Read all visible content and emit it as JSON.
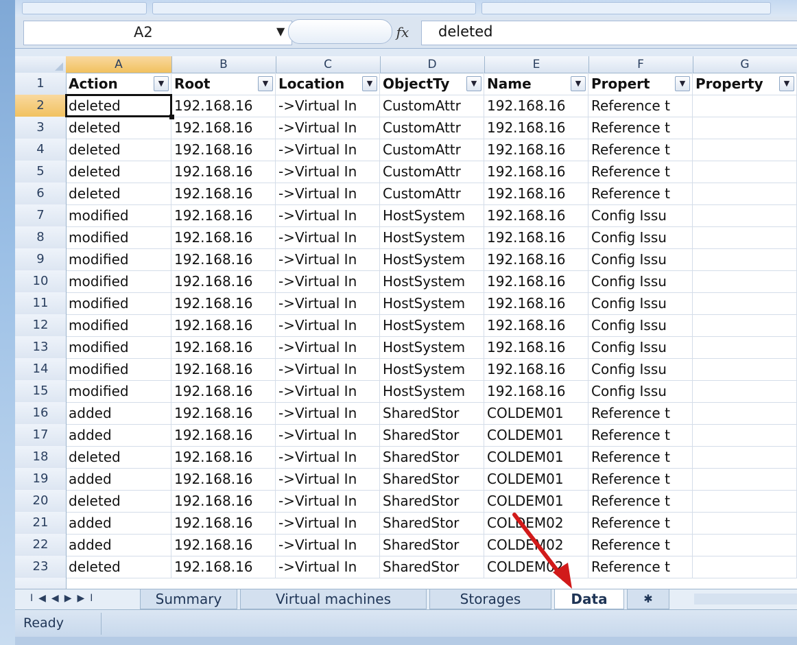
{
  "formula_bar": {
    "name_box": "A2",
    "fx_label": "fx",
    "content": "deleted"
  },
  "columns": [
    "A",
    "B",
    "C",
    "D",
    "E",
    "F",
    "G"
  ],
  "header_row": {
    "number": "1",
    "cells": [
      "Action",
      "Root",
      "Location",
      "ObjectTy",
      "Name",
      "Propert",
      "Property"
    ]
  },
  "rows": [
    {
      "n": "2",
      "cells": [
        "deleted",
        "192.168.16",
        "->Virtual In",
        "CustomAttr",
        "192.168.16",
        "Reference t"
      ]
    },
    {
      "n": "3",
      "cells": [
        "deleted",
        "192.168.16",
        "->Virtual In",
        "CustomAttr",
        "192.168.16",
        "Reference t"
      ]
    },
    {
      "n": "4",
      "cells": [
        "deleted",
        "192.168.16",
        "->Virtual In",
        "CustomAttr",
        "192.168.16",
        "Reference t"
      ]
    },
    {
      "n": "5",
      "cells": [
        "deleted",
        "192.168.16",
        "->Virtual In",
        "CustomAttr",
        "192.168.16",
        "Reference t"
      ]
    },
    {
      "n": "6",
      "cells": [
        "deleted",
        "192.168.16",
        "->Virtual In",
        "CustomAttr",
        "192.168.16",
        "Reference t"
      ]
    },
    {
      "n": "7",
      "cells": [
        "modified",
        "192.168.16",
        "->Virtual In",
        "HostSystem",
        "192.168.16",
        "Config Issu"
      ]
    },
    {
      "n": "8",
      "cells": [
        "modified",
        "192.168.16",
        "->Virtual In",
        "HostSystem",
        "192.168.16",
        "Config Issu"
      ]
    },
    {
      "n": "9",
      "cells": [
        "modified",
        "192.168.16",
        "->Virtual In",
        "HostSystem",
        "192.168.16",
        "Config Issu"
      ]
    },
    {
      "n": "10",
      "cells": [
        "modified",
        "192.168.16",
        "->Virtual In",
        "HostSystem",
        "192.168.16",
        "Config Issu"
      ]
    },
    {
      "n": "11",
      "cells": [
        "modified",
        "192.168.16",
        "->Virtual In",
        "HostSystem",
        "192.168.16",
        "Config Issu"
      ]
    },
    {
      "n": "12",
      "cells": [
        "modified",
        "192.168.16",
        "->Virtual In",
        "HostSystem",
        "192.168.16",
        "Config Issu"
      ]
    },
    {
      "n": "13",
      "cells": [
        "modified",
        "192.168.16",
        "->Virtual In",
        "HostSystem",
        "192.168.16",
        "Config Issu"
      ]
    },
    {
      "n": "14",
      "cells": [
        "modified",
        "192.168.16",
        "->Virtual In",
        "HostSystem",
        "192.168.16",
        "Config Issu"
      ]
    },
    {
      "n": "15",
      "cells": [
        "modified",
        "192.168.16",
        "->Virtual In",
        "HostSystem",
        "192.168.16",
        "Config Issu"
      ]
    },
    {
      "n": "16",
      "cells": [
        "added",
        "192.168.16",
        "->Virtual In",
        "SharedStor",
        "COLDEM01",
        "Reference t"
      ]
    },
    {
      "n": "17",
      "cells": [
        "added",
        "192.168.16",
        "->Virtual In",
        "SharedStor",
        "COLDEM01",
        "Reference t"
      ]
    },
    {
      "n": "18",
      "cells": [
        "deleted",
        "192.168.16",
        "->Virtual In",
        "SharedStor",
        "COLDEM01",
        "Reference t"
      ]
    },
    {
      "n": "19",
      "cells": [
        "added",
        "192.168.16",
        "->Virtual In",
        "SharedStor",
        "COLDEM01",
        "Reference t"
      ]
    },
    {
      "n": "20",
      "cells": [
        "deleted",
        "192.168.16",
        "->Virtual In",
        "SharedStor",
        "COLDEM01",
        "Reference t"
      ]
    },
    {
      "n": "21",
      "cells": [
        "added",
        "192.168.16",
        "->Virtual In",
        "SharedStor",
        "COLDEM02",
        "Reference t"
      ]
    },
    {
      "n": "22",
      "cells": [
        "added",
        "192.168.16",
        "->Virtual In",
        "SharedStor",
        "COLDEM02",
        "Reference t"
      ]
    },
    {
      "n": "23",
      "cells": [
        "deleted",
        "192.168.16",
        "->Virtual In",
        "SharedStor",
        "COLDEM02",
        "Reference t"
      ]
    }
  ],
  "sheet_tabs": {
    "nav_icons": [
      "first-sheet-icon",
      "prev-sheet-icon",
      "next-sheet-icon",
      "last-sheet-icon"
    ],
    "tabs": [
      "Summary",
      "Virtual machines",
      "Storages",
      "Data"
    ],
    "active": "Data"
  },
  "status_bar": {
    "text": "Ready"
  },
  "colors": {
    "selection_header": "#f1c15f",
    "arrow": "#d11a1a"
  }
}
